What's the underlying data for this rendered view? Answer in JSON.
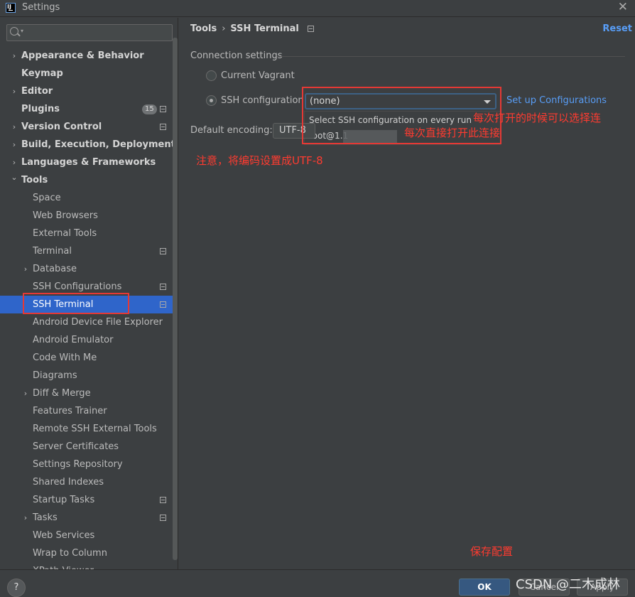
{
  "window": {
    "title": "Settings",
    "close_glyph": "✕"
  },
  "sidebar": {
    "search_placeholder": "",
    "items": [
      {
        "label": "Appearance & Behavior",
        "level": 0,
        "bold": true,
        "expandable": true,
        "expanded": false
      },
      {
        "label": "Keymap",
        "level": 0,
        "bold": true
      },
      {
        "label": "Editor",
        "level": 0,
        "bold": true,
        "expandable": true,
        "expanded": false
      },
      {
        "label": "Plugins",
        "level": 0,
        "bold": true,
        "badge": "15",
        "project_icon": true
      },
      {
        "label": "Version Control",
        "level": 0,
        "bold": true,
        "expandable": true,
        "expanded": false,
        "project_icon": true
      },
      {
        "label": "Build, Execution, Deployment",
        "level": 0,
        "bold": true,
        "expandable": true,
        "expanded": false
      },
      {
        "label": "Languages & Frameworks",
        "level": 0,
        "bold": true,
        "expandable": true,
        "expanded": false
      },
      {
        "label": "Tools",
        "level": 0,
        "bold": true,
        "expandable": true,
        "expanded": true
      },
      {
        "label": "Space",
        "level": 1
      },
      {
        "label": "Web Browsers",
        "level": 1
      },
      {
        "label": "External Tools",
        "level": 1
      },
      {
        "label": "Terminal",
        "level": 1,
        "project_icon": true
      },
      {
        "label": "Database",
        "level": 1,
        "expandable": true,
        "expanded": false
      },
      {
        "label": "SSH Configurations",
        "level": 1,
        "project_icon": true
      },
      {
        "label": "SSH Terminal",
        "level": 1,
        "project_icon": true,
        "selected": true
      },
      {
        "label": "Android Device File Explorer",
        "level": 1
      },
      {
        "label": "Android Emulator",
        "level": 1
      },
      {
        "label": "Code With Me",
        "level": 1
      },
      {
        "label": "Diagrams",
        "level": 1
      },
      {
        "label": "Diff & Merge",
        "level": 1,
        "expandable": true,
        "expanded": false
      },
      {
        "label": "Features Trainer",
        "level": 1
      },
      {
        "label": "Remote SSH External Tools",
        "level": 1
      },
      {
        "label": "Server Certificates",
        "level": 1
      },
      {
        "label": "Settings Repository",
        "level": 1
      },
      {
        "label": "Shared Indexes",
        "level": 1
      },
      {
        "label": "Startup Tasks",
        "level": 1,
        "project_icon": true
      },
      {
        "label": "Tasks",
        "level": 1,
        "expandable": true,
        "expanded": false,
        "project_icon": true
      },
      {
        "label": "Web Services",
        "level": 1
      },
      {
        "label": "Wrap to Column",
        "level": 1
      },
      {
        "label": "XPath Viewer",
        "level": 1
      }
    ]
  },
  "main": {
    "breadcrumb": {
      "parent": "Tools",
      "separator": "›",
      "current": "SSH Terminal"
    },
    "reset_label": "Reset",
    "section_title": "Connection settings",
    "radio_current_vagrant": "Current Vagrant",
    "radio_ssh_configuration": "SSH configuration",
    "selected_radio": "SSH configuration",
    "ssh_combo_value": "(none)",
    "dropdown_options": [
      "Select SSH configuration on every run",
      "root@1.1"
    ],
    "setup_link": "Set up Configurations",
    "encoding_label": "Default encoding:",
    "encoding_value": "UTF-8"
  },
  "annotations": {
    "note_every_time": "每次打开的时候可以选择连",
    "note_direct": "每次直接打开此连接",
    "note_encoding": "注意，将编码设置成UTF-8",
    "note_save": "保存配置",
    "color": "#ff3b30"
  },
  "buttons": {
    "help": "?",
    "ok": "OK",
    "cancel": "Cancel",
    "apply": "Apply"
  },
  "watermark": "CSDN @二木成林",
  "colors": {
    "selection": "#2f65ca",
    "link": "#589df6",
    "ok_button": "#365880"
  }
}
